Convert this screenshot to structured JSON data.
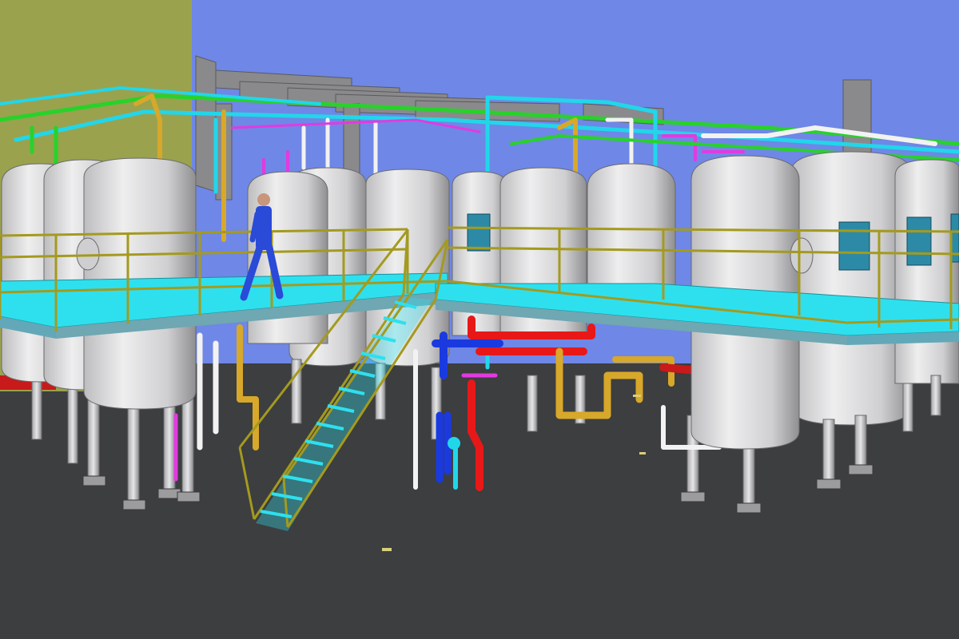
{
  "scene": {
    "kind": "3d-plant-model-render",
    "colors": {
      "sky": "#6f87e6",
      "ground": "#3c3e40",
      "wall": "#9aa24e",
      "tank": "#d4d4d6",
      "tank_shade": "#9c9c9e",
      "platform_deck": "#2ee0ee",
      "handrail": "#a49a1e",
      "pipe_cyan": "#22d6ea",
      "pipe_yellow": "#d7a82a",
      "pipe_green": "#28d22a",
      "pipe_magenta": "#e23ae0",
      "pipe_red": "#e81818",
      "pipe_blue": "#1a3ae0",
      "pipe_white": "#f2f2f2",
      "steel_beam": "#8a8a8a",
      "worker_uniform": "#2a4ad8"
    },
    "objects": [
      "vertical-storage-tank",
      "elevated-walkway-platform",
      "handrail",
      "access-staircase",
      "process-pipework",
      "overhead-pipe-rack",
      "roof-steel-beams",
      "control-panel",
      "worker-figure"
    ]
  }
}
